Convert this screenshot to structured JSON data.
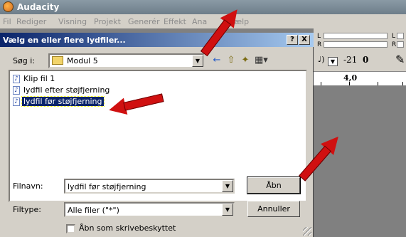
{
  "app": {
    "title": "Audacity",
    "menu": [
      "Fil",
      "Rediger",
      "Visning",
      "Projekt",
      "Generér",
      "Effekt",
      "Ana",
      "Hjælp"
    ]
  },
  "toolbar": {
    "meter_left": "L",
    "meter_right": "R",
    "volume_level": "-21",
    "zero_mark": "0",
    "ruler_value": "4,0"
  },
  "dialog": {
    "title": "Vælg en eller flere lydfiler...",
    "help_button": "?",
    "close_button": "X",
    "lookin_label": "Søg i:",
    "lookin_value": "Modul 5",
    "files": [
      {
        "name": "Klip fil 1",
        "selected": false
      },
      {
        "name": "lydfil efter støjfjerning",
        "selected": false
      },
      {
        "name": "lydfil før støjfjerning",
        "selected": true
      }
    ],
    "filename_label": "Filnavn:",
    "filename_value": "lydfil før støjfjerning",
    "filetype_label": "Filtype:",
    "filetype_value": "Alle filer (\"*\")",
    "open_button": "Åbn",
    "cancel_button": "Annuller",
    "readonly_label": "Åbn som skrivebeskyttet"
  },
  "colors": {
    "arrow": "#d01010",
    "selection": "#0a246a",
    "dialog_bg": "#d4d0c8"
  }
}
